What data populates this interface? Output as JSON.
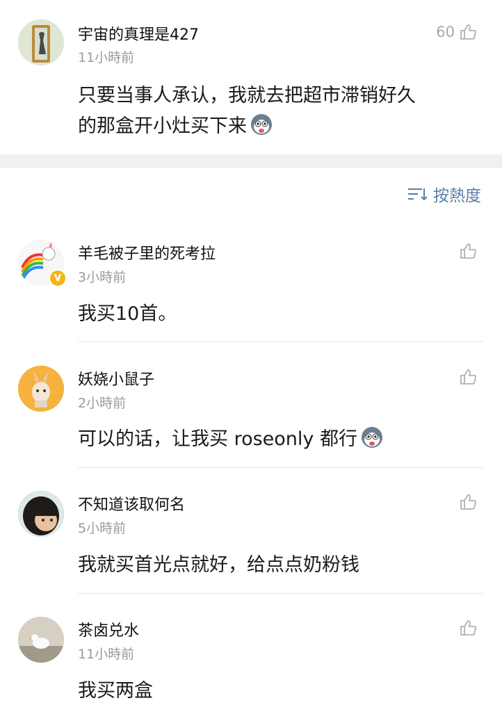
{
  "top_comment": {
    "username": "宇宙的真理是427",
    "time": "11小時前",
    "like_count": "60",
    "text_line1": "只要当事人承认，我就去把超市滞销好久",
    "text_line2": "的那盒开小灶买下来",
    "emoji": "husky-emoji"
  },
  "sort": {
    "label": "按熱度",
    "icon": "sort-icon"
  },
  "replies": [
    {
      "username": "羊毛被子里的死考拉",
      "time": "3小時前",
      "text": "我买10首。",
      "verified": true
    },
    {
      "username": "妖娆小鼠子",
      "time": "2小時前",
      "text": "可以的话，让我买 roseonly 都行",
      "emoji": "husky-emoji"
    },
    {
      "username": "不知道该取何名",
      "time": "5小時前",
      "text": "我就买首光点就好，给点点奶粉钱"
    },
    {
      "username": "茶卤兑水",
      "time": "11小時前",
      "text": "我买两盒"
    }
  ],
  "colors": {
    "link": "#5a7fa8",
    "secondary_text": "#9a9a9a",
    "badge": "#f6b31b"
  }
}
